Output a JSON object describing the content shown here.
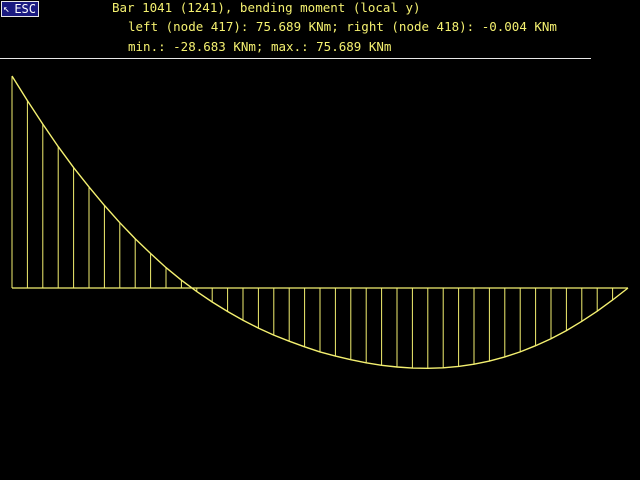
{
  "toolbar": {
    "esc_label": "ESC",
    "esc_arrow": "↖"
  },
  "header": {
    "title": "Bar 1041 (1241), bending moment (local y)",
    "ends": "left (node 417): 75.689 KNm; right (node 418): -0.004 KNm",
    "minmax": "min.: -28.683 KNm; max.: 75.689 KNm"
  },
  "colors": {
    "background": "#000000",
    "text": "#f4f070",
    "diagram_stroke": "#f4f070",
    "rule": "#e8e8e8",
    "esc_fill": "#1a1a80"
  },
  "chart_data": {
    "type": "line",
    "title": "",
    "xlabel": "",
    "ylabel": "",
    "x_range": [
      0,
      1
    ],
    "ylim": [
      -28.683,
      75.689
    ],
    "ordinates": 41,
    "series": [
      {
        "values": [
          75.689,
          66.9,
          58.5,
          50.5,
          43.0,
          36.1,
          29.5,
          23.3,
          17.6,
          12.3,
          7.3,
          2.8,
          -1.3,
          -5.0,
          -8.4,
          -11.5,
          -14.3,
          -16.8,
          -19.0,
          -21.0,
          -22.8,
          -24.3,
          -25.6,
          -26.7,
          -27.6,
          -28.2,
          -28.6,
          -28.683,
          -28.5,
          -28.0,
          -27.2,
          -26.1,
          -24.6,
          -22.8,
          -20.6,
          -18.1,
          -15.2,
          -11.9,
          -8.3,
          -4.3,
          -0.004
        ]
      }
    ]
  }
}
